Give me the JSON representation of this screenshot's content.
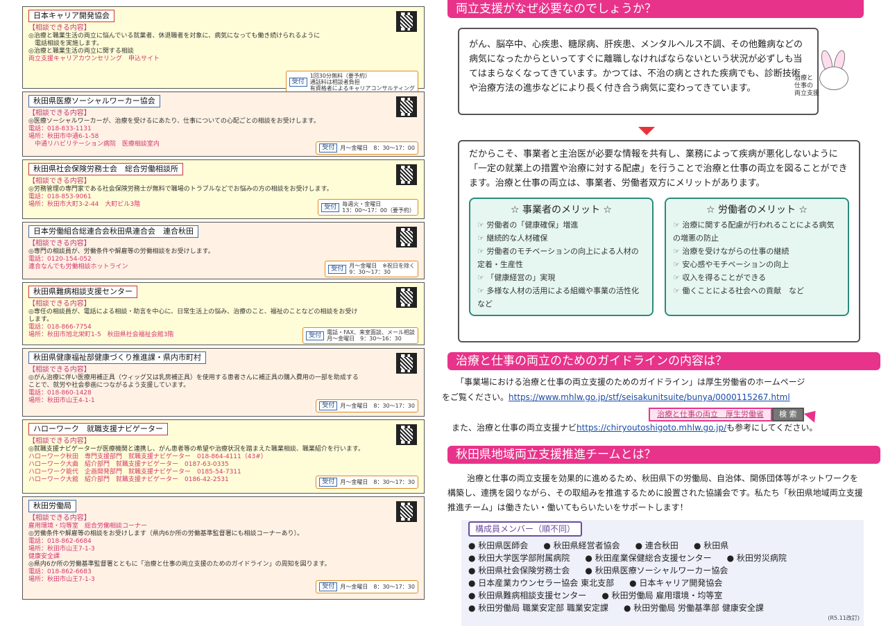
{
  "left": {
    "cards": [
      {
        "name": "日本キャリア開発協会",
        "title": "【相談できる内容】",
        "desc": [
          "◎治療と職業生活の両立に悩んでいる就業者、休退職者を対象に、病気になっても働き続けられるように",
          "　電話相談を実施します。",
          "◎治療と職業生活の両立に関する相談"
        ],
        "pink": [
          "両立支援キャリアカウンセリング　申込サイト"
        ],
        "recv_btn": "受付",
        "recv_text": [
          "1回30分無料（要予約）",
          "通話料は相談者負担",
          "有資格者によるキャリアコンサルティング"
        ]
      },
      {
        "name": "秋田県医療ソーシャルワーカー協会",
        "title": "【相談できる内容】",
        "desc": [
          "◎医療ソーシャルワーカーが、治療を受けるにあたり、仕事についての心配ごとの相談をお受けします。"
        ],
        "pink": [
          "電話：018-833-1131",
          "場所：秋田市中通6-1-58",
          "　中通リハビリテーション病院　医療相談室内"
        ],
        "recv_btn": "受付",
        "recv_text": [
          "月～金曜日　8：30～17：00"
        ]
      },
      {
        "name": "秋田県社会保険労務士会　総合労働相談所",
        "title": "【相談できる内容】",
        "desc": [
          "◎労務管理の専門家である社会保険労務士が無料で職場のトラブルなどでお悩みの方の相談をお受けします。"
        ],
        "pink": [
          "電話：018-853-9061",
          "場所：秋田市大町3-2-44　大町ビル3階"
        ],
        "recv_btn": "受付",
        "recv_text": [
          "毎週火・金曜日",
          "13：00～17：00（要予約）"
        ]
      },
      {
        "name": "日本労働組合総連合会秋田県連合会　連合秋田",
        "title": "【相談できる内容】",
        "desc": [
          "◎専門の相談員が、労働条件や解雇等の労働相談をお受けします。"
        ],
        "pink": [
          "電話：0120-154-052",
          "連合なんでも労働相談ホットライン"
        ],
        "recv_btn": "受付",
        "recv_text": [
          "月～金曜日　※祝日を除く",
          "9：30～17：30"
        ]
      },
      {
        "name": "秋田県難病相談支援センター",
        "title": "【相談できる内容】",
        "desc": [
          "◎専任の相談員が、電話による相談・助言を中心に、日常生活上の悩み、治療のこと、福祉のことなどの相談をお受け",
          "します。"
        ],
        "pink": [
          "電話：018-866-7754",
          "場所：秋田市旭北栄町1-5　秋田県社会福祉会館3階"
        ],
        "recv_btn": "受付",
        "recv_text": [
          "電話・FAX、来室面談、メール相談",
          "月～金曜日　9：30～16：30"
        ]
      },
      {
        "name": "秋田県健康福祉部健康づくり推進課・県内市町村",
        "title": "【相談できる内容】",
        "desc": [
          "◎がん治療に伴い医療用補正具（ウィッグ又は乳房補正具）を使用する患者さんに補正具の購入費用の一部を助成する",
          "ことで、就労や社会参画につながるよう支援しています。"
        ],
        "pink": [
          "電話：018-860-1428",
          "場所：秋田市山王4-1-1"
        ],
        "recv_btn": "受付",
        "recv_text": [
          "月～金曜日　8：30～17：30"
        ]
      },
      {
        "name": "ハローワーク　就職支援ナビゲーター",
        "title": "【相談できる内容】",
        "desc": [
          "◎就職支援ナビゲーターが医療機関と連携し、がん患者等の希望や治療状況を踏まえた職業相談、職業紹介を行います。"
        ],
        "pink": [
          "ハローワーク秋田　専門支援部門　就職支援ナビゲーター　018-864-4111（43#）",
          "ハローワーク大曲　紹介部門　就職支援ナビゲーター　0187-63-0335",
          "ハローワーク能代　企画開発部門　就職支援ナビゲーター　0185-54-7311",
          "ハローワーク大館　紹介部門　就職支援ナビゲーター　0186-42-2531"
        ],
        "recv_btn": "受付",
        "recv_text": [
          "月～金曜日　8：30～17：30"
        ]
      },
      {
        "name": "秋田労働局",
        "title": "【相談できる内容】",
        "desc": [],
        "pink": [
          "雇用環境・均等室　総合労働相談コーナー"
        ],
        "desc2": [
          "◎労働条件や解雇等の相談をお受けします（県内6か所の労働基準監督署にも相談コーナーあり）。"
        ],
        "pink2": [
          "電話：018-862-6684",
          "場所：秋田市山王7-1-3",
          "健康安全課"
        ],
        "desc3": [
          "◎県内6か所の労働基準監督署とともに「治療と仕事の両立支援のためのガイドライン」の周知を図ります。"
        ],
        "pink3": [
          "電話：018-862-6683",
          "場所：秋田市山王7-1-3"
        ],
        "recv_btn": "受付",
        "recv_text": [
          "月～金曜日　8：30～17：30"
        ]
      }
    ]
  },
  "right": {
    "h1": "両立支援がなぜ必要なのでしょうか？",
    "box1": "がん、脳卒中、心疾患、糖尿病、肝疾患、メンタルヘルス不調、その他難病などの病気になったからといってすぐに離職しなければならないという状況が必ずしも当てはまらなくなってきています。かつては、不治の病とされた疾病でも、診断技術や治療方法の進歩などにより長く付き合う病気に変わってきています。",
    "rabbit_label": [
      "治療と",
      "仕事の",
      "両立支援"
    ],
    "box2": "だからこそ、事業者と主治医が必要な情報を共有し、業務によって疾病が悪化しないように「一定の就業上の措置や治療に対する配慮」を行うことで治療と仕事の両立を図ることができます。治療と仕事の両立は、事業者、労働者双方にメリットがあります。",
    "merit_employer": {
      "title": "☆ 事業者のメリット ☆",
      "items": [
        "労働者の「健康確保」増進",
        "継続的な人材確保",
        "労働者のモチベーションの向上による人材の定着・生産性",
        "「健康経営の」実現",
        "多様な人材の活用による組織や事業の活性化　など"
      ]
    },
    "merit_worker": {
      "title": "☆ 労働者のメリット ☆",
      "items": [
        "治療に関する配慮が行われることによる病気の増悪の防止",
        "治療を受けながらの仕事の継続",
        "安心感やモチベーションの向上",
        "収入を得ることができる",
        "働くことによる社会への貢献　など"
      ]
    },
    "h2": "治療と仕事の両立のためのガイドラインの内容は？",
    "guide1": "「事業場における治療と仕事の両立支援のためのガイドライン」は厚生労働省のホームページ",
    "guide2_pre": "をご覧ください。",
    "guide2_link": "https://www.mhlw.go.jp/stf/seisakunitsuite/bunya/0000115267.html",
    "search_query": "治療と仕事の両立　厚生労働省",
    "search_btn": "検 索",
    "guide3_pre": "また、治療と仕事の両立支援ナビ",
    "guide3_link": "https://chiryoutoshigoto.mhlw.go.jp/",
    "guide3_post": "も参考にしてください。",
    "h3": "秋田県地域両立支援推進チームとは？",
    "team": "治療と仕事の両立支援を効果的に進めるため、秋田県下の労働局、自治体、関係団体等がネットワークを構築し、連携を図りながら、その取組みを推進するために設置された協議会です。私たち「秋田県地域両立支援推進チーム」は働きたい・働いてもらいたいをサポートします！",
    "members_title": "構成員メンバー（順不同）",
    "members": [
      [
        "秋田県医師会",
        "秋田県経営者協会",
        "連合秋田",
        "秋田県"
      ],
      [
        "秋田大学医学部附属病院",
        "秋田産業保健総合支援センター",
        "秋田労災病院"
      ],
      [
        "秋田県社会保険労務士会",
        "秋田県医療ソーシャルワーカー協会"
      ],
      [
        "日本産業カウンセラー協会 東北支部",
        "日本キャリア開発協会"
      ],
      [
        "秋田県難病相談支援センター",
        "秋田労働局 雇用環境・均等室"
      ],
      [
        "秋田労働局 職業安定部 職業安定課",
        "秋田労働局 労働基準部 健康安全課"
      ]
    ],
    "note": "(R5.11改訂)"
  }
}
